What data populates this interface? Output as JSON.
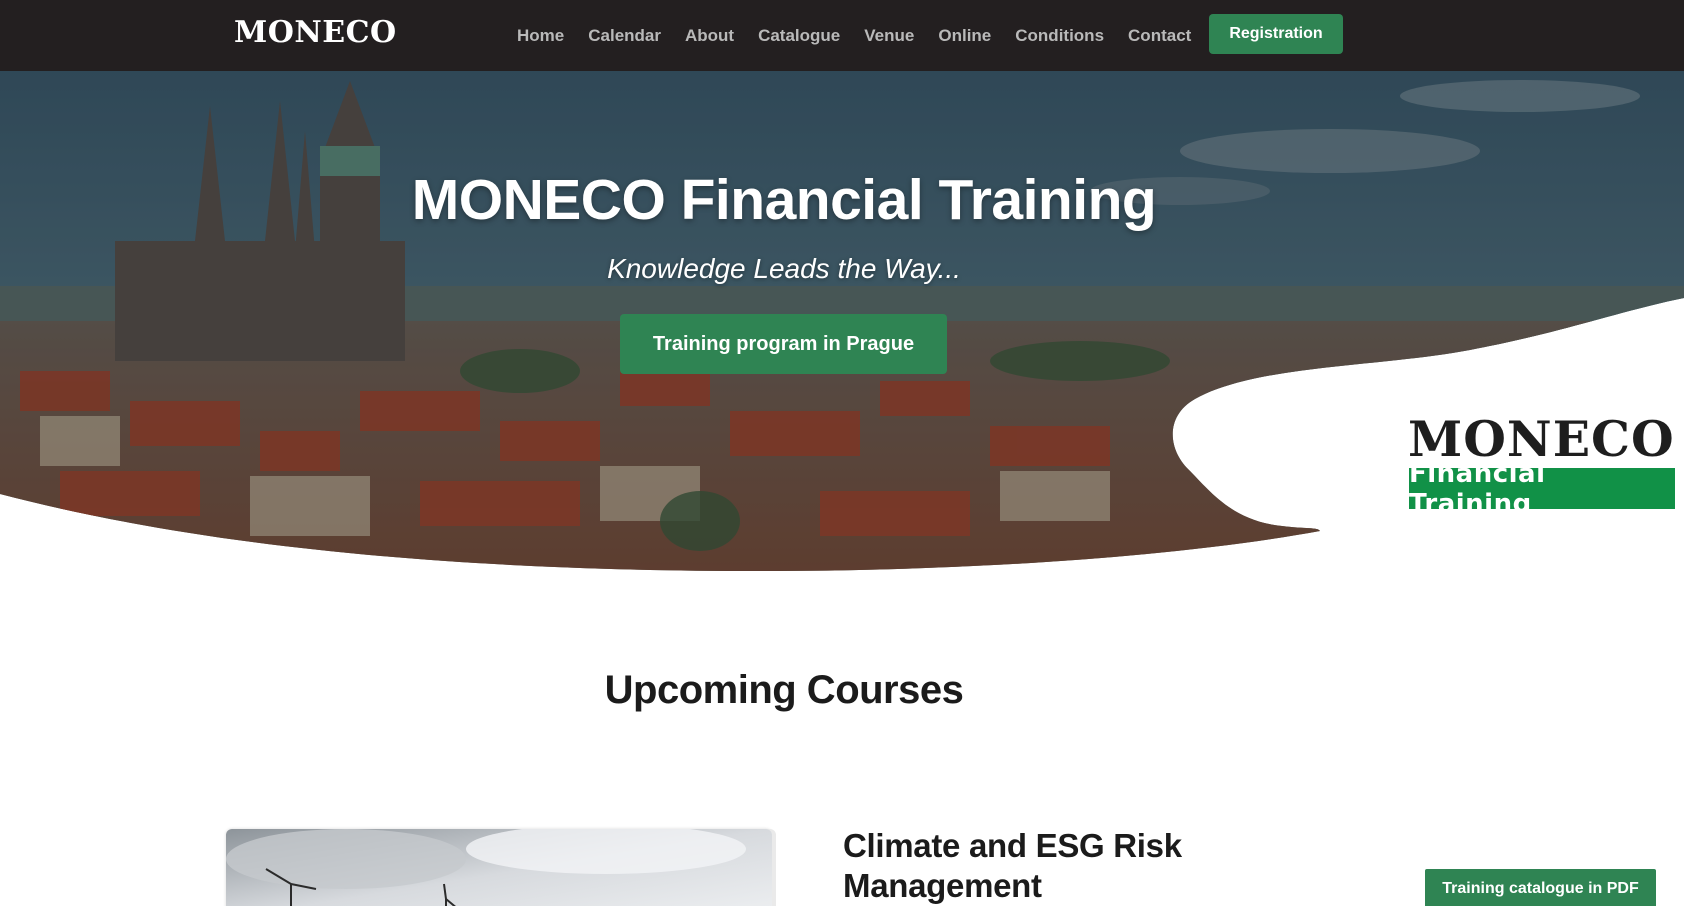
{
  "navbar": {
    "brand": "MONECO",
    "links": [
      "Home",
      "Calendar",
      "About",
      "Catalogue",
      "Venue",
      "Online",
      "Conditions",
      "Contact"
    ],
    "register_label": "Registration"
  },
  "hero": {
    "title": "MONECO Financial Training",
    "subtitle": "Knowledge Leads the Way...",
    "cta_label": "Training program in Prague",
    "logo_word": "MONECO",
    "logo_tag": "Financial Training"
  },
  "courses": {
    "heading": "Upcoming Courses",
    "first_course_title": "Climate and ESG Risk Management"
  },
  "floating": {
    "pdf_label": "Training catalogue in PDF"
  },
  "colors": {
    "nav_bg": "#231f20",
    "accent_green": "#2f8453",
    "logo_green": "#119147"
  }
}
